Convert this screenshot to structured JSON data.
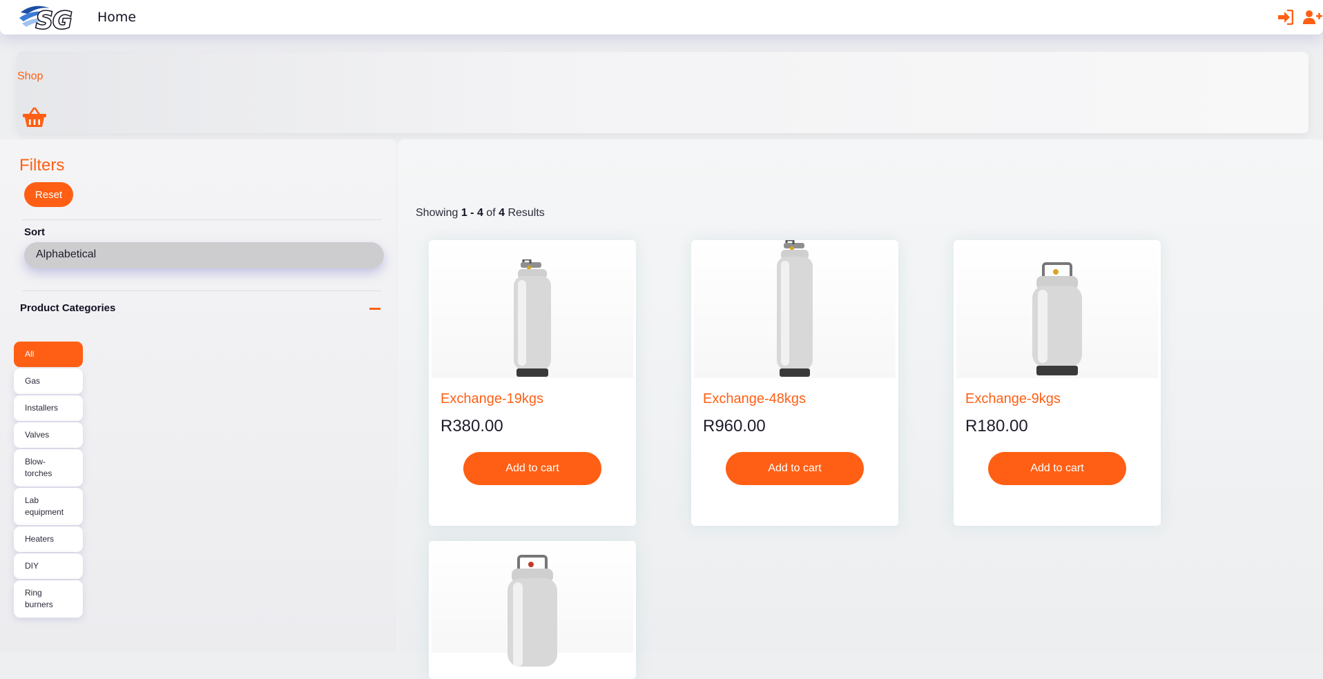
{
  "header": {
    "logo_text": "SG",
    "home_label": "Home",
    "icons": [
      "sign-in-icon",
      "add-user-icon"
    ],
    "accent_color": "#ff5f14"
  },
  "banner": {
    "shop_label": "Shop",
    "icon": "basket-icon"
  },
  "filters": {
    "title": "Filters",
    "reset_label": "Reset",
    "sort_label": "Sort",
    "sort_value": "Alphabetical",
    "categories_label": "Product Categories",
    "categories": [
      {
        "label": "All",
        "active": true
      },
      {
        "label": "Gas",
        "active": false
      },
      {
        "label": "Installers",
        "active": false
      },
      {
        "label": "Valves",
        "active": false
      },
      {
        "label": "Blow-torches",
        "active": false
      },
      {
        "label": "Lab equipment",
        "active": false
      },
      {
        "label": "Heaters",
        "active": false
      },
      {
        "label": "DIY",
        "active": false
      },
      {
        "label": "Ring burners",
        "active": false
      }
    ]
  },
  "results": {
    "prefix": "Showing",
    "range": "1 - 4",
    "of": "of",
    "total": "4",
    "suffix": "Results"
  },
  "products": [
    {
      "name": "Exchange-19kgs",
      "price": "R380.00",
      "button": "Add to cart"
    },
    {
      "name": "Exchange-48kgs",
      "price": "R960.00",
      "button": "Add to cart"
    },
    {
      "name": "Exchange-9kgs",
      "price": "R180.00",
      "button": "Add to cart"
    },
    {
      "name": "",
      "price": "",
      "button": ""
    }
  ]
}
